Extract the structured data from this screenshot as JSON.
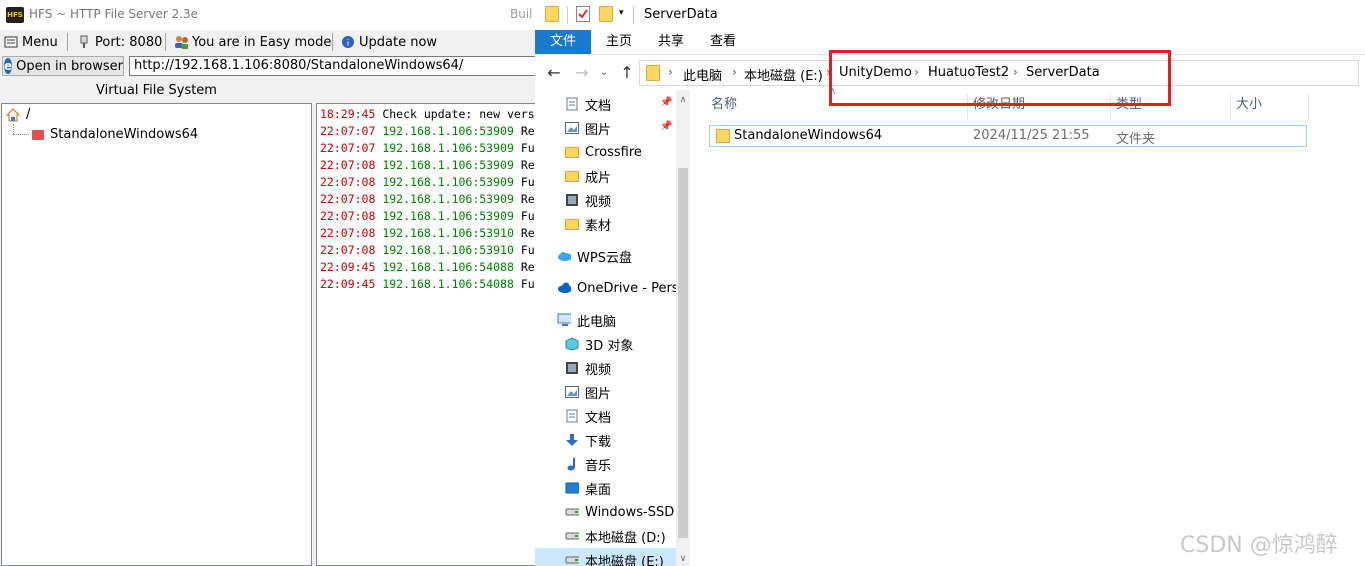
{
  "hfs": {
    "title": "HFS ~ HTTP File Server 2.3e",
    "build_fragment": "Buil",
    "logo_text": "HFS",
    "toolbar": {
      "menu": "Menu",
      "port": "Port: 8080",
      "mode": "You are in Easy mode",
      "update": "Update now"
    },
    "open_browser": "Open in browser",
    "url": "http://192.168.1.106:8080/StandaloneWindows64/",
    "vfs": {
      "header": "Virtual File System",
      "root": "/",
      "child": "StandaloneWindows64"
    },
    "log": [
      {
        "time": "18:29:45",
        "ip": "",
        "msg": "Check update: new vers"
      },
      {
        "time": "22:07:07",
        "ip": "192.168.1.106:53909",
        "msg": "Re"
      },
      {
        "time": "22:07:07",
        "ip": "192.168.1.106:53909",
        "msg": "Fu"
      },
      {
        "time": "22:07:08",
        "ip": "192.168.1.106:53909",
        "msg": "Re"
      },
      {
        "time": "22:07:08",
        "ip": "192.168.1.106:53909",
        "msg": "Fu"
      },
      {
        "time": "22:07:08",
        "ip": "192.168.1.106:53909",
        "msg": "Re"
      },
      {
        "time": "22:07:08",
        "ip": "192.168.1.106:53909",
        "msg": "Fu"
      },
      {
        "time": "22:07:08",
        "ip": "192.168.1.106:53910",
        "msg": "Re"
      },
      {
        "time": "22:07:08",
        "ip": "192.168.1.106:53910",
        "msg": "Fu"
      },
      {
        "time": "22:09:45",
        "ip": "192.168.1.106:54088",
        "msg": "Re"
      },
      {
        "time": "22:09:45",
        "ip": "192.168.1.106:54088",
        "msg": "Fu"
      }
    ],
    "colors": {
      "time": "#c00000",
      "ip": "#008000"
    }
  },
  "explorer": {
    "title": "ServerData",
    "tabs": [
      "文件",
      "主页",
      "共享",
      "查看"
    ],
    "breadcrumb": [
      "此电脑",
      "本地磁盘 (E:)",
      "UnityDemo",
      "HuatuoTest2",
      "ServerData"
    ],
    "nav_items": [
      {
        "label": "文档",
        "icon": "document-icon",
        "pinned": true
      },
      {
        "label": "图片",
        "icon": "picture-icon",
        "pinned": true
      },
      {
        "label": "Crossfire",
        "icon": "folder-icon"
      },
      {
        "label": "成片",
        "icon": "folder-icon"
      },
      {
        "label": "视频",
        "icon": "video-icon"
      },
      {
        "label": "素材",
        "icon": "folder-icon"
      },
      {
        "label": "WPS云盘",
        "icon": "cloud-icon"
      },
      {
        "label": "OneDrive - Perso",
        "icon": "onedrive-icon"
      },
      {
        "label": "此电脑",
        "icon": "computer-icon"
      },
      {
        "label": "3D 对象",
        "icon": "cube-icon"
      },
      {
        "label": "视频",
        "icon": "video-icon"
      },
      {
        "label": "图片",
        "icon": "picture-icon"
      },
      {
        "label": "文档",
        "icon": "document-icon"
      },
      {
        "label": "下载",
        "icon": "download-icon"
      },
      {
        "label": "音乐",
        "icon": "music-icon"
      },
      {
        "label": "桌面",
        "icon": "desktop-icon"
      },
      {
        "label": "Windows-SSD",
        "icon": "drive-icon"
      },
      {
        "label": "本地磁盘 (D:)",
        "icon": "drive-icon"
      },
      {
        "label": "本地磁盘 (E:)",
        "icon": "drive-icon",
        "selected": true
      }
    ],
    "columns": [
      "名称",
      "修改日期",
      "类型",
      "大小"
    ],
    "files": [
      {
        "name": "StandaloneWindows64",
        "date": "2024/11/25 21:55",
        "type": "文件夹",
        "size": ""
      }
    ],
    "colors": {
      "ribbon_active": "#1979ca",
      "highlight_box": "#e02020",
      "selection": "#cce8ff"
    }
  },
  "watermark": "CSDN @惊鸿醉"
}
